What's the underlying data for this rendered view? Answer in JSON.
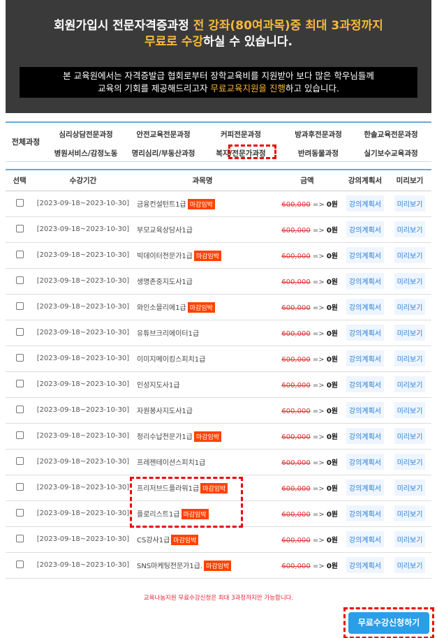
{
  "banner": {
    "line1_a": "회원가입시 전문자격증과정 ",
    "line1_hl": "전 강좌(80여과목)중 최대 3과정까지",
    "line2_hl": "무료로 수강",
    "line2_b": "하실 수 있습니다.",
    "notice_line1": "본 교육원에서는 자격증발급 협회로부터 장학교육비를 지원받아 보다 많은 학우님들께",
    "notice_line2_a": "교육의 기회를 제공해드리고자 ",
    "notice_line2_hl": "무료교육지원을 진행",
    "notice_line2_b": "하고 있습니다."
  },
  "categories": {
    "all": "전체과정",
    "items": [
      "심리상담전문과정",
      "안전교육전문과정",
      "커피전문과정",
      "방과후전문과정",
      "한솔교육전문과정",
      "병원서비스/감정노동",
      "명리심리/부동산과정",
      "복지/전문가과정",
      "반려동물과정",
      "실기보수교육과정"
    ],
    "selected": "복지/전문가과정"
  },
  "table": {
    "headers": [
      "선택",
      "수강기간",
      "과목명",
      "금액",
      "강의계획서",
      "미리보기"
    ],
    "rows": [
      {
        "period": "[2023-09-18~2023-10-30]",
        "title": "금융컨설턴트1급",
        "badge": "마감임박"
      },
      {
        "period": "[2023-09-18~2023-10-30]",
        "title": "부모교육상담사1급",
        "badge": ""
      },
      {
        "period": "[2023-09-18~2023-10-30]",
        "title": "빅데이터전문가1급",
        "badge": "마감임박"
      },
      {
        "period": "[2023-09-18~2023-10-30]",
        "title": "생명존중지도사1급",
        "badge": ""
      },
      {
        "period": "[2023-09-18~2023-10-30]",
        "title": "와인소믈리에1급",
        "badge": "마감임박"
      },
      {
        "period": "[2023-09-18~2023-10-30]",
        "title": "유튜브크리에이터1급",
        "badge": ""
      },
      {
        "period": "[2023-09-18~2023-10-30]",
        "title": "이미지메이킹스피치1급",
        "badge": ""
      },
      {
        "period": "[2023-09-18~2023-10-30]",
        "title": "인성지도사1급",
        "badge": ""
      },
      {
        "period": "[2023-09-18~2023-10-30]",
        "title": "자원봉사지도사1급",
        "badge": ""
      },
      {
        "period": "[2023-09-18~2023-10-30]",
        "title": "정리수납전문가1급",
        "badge": "마감임박"
      },
      {
        "period": "[2023-09-18~2023-10-30]",
        "title": "프레젠테이션스피치1급",
        "badge": ""
      },
      {
        "period": "[2023-09-18~2023-10-30]",
        "title": "프리저브드플라워1급",
        "badge": "마감임박"
      },
      {
        "period": "[2023-09-18~2023-10-30]",
        "title": "플로리스트1급",
        "badge": "마감임박"
      },
      {
        "period": "[2023-09-18~2023-10-30]",
        "title": "CS강사1급",
        "badge": "마감임박"
      },
      {
        "period": "[2023-09-18~2023-10-30]",
        "title": "SNS마케팅전문가1급.",
        "badge": "마감임박"
      }
    ],
    "price_original": "600,000",
    "price_arrow": " => ",
    "price_free": "0원",
    "plan_label": "강의계획서",
    "preview_label": "미리보기"
  },
  "footer": {
    "note": "교육나눔지원 무료수강신청은 최대 3과정까지만 가능합니다.",
    "apply_button": "무료수강신청하기"
  },
  "colors": {
    "accent_yellow": "#f6b93b",
    "badge_orange": "#ff4200",
    "button_blue": "#2a9ee6",
    "highlight_red": "#e00"
  }
}
